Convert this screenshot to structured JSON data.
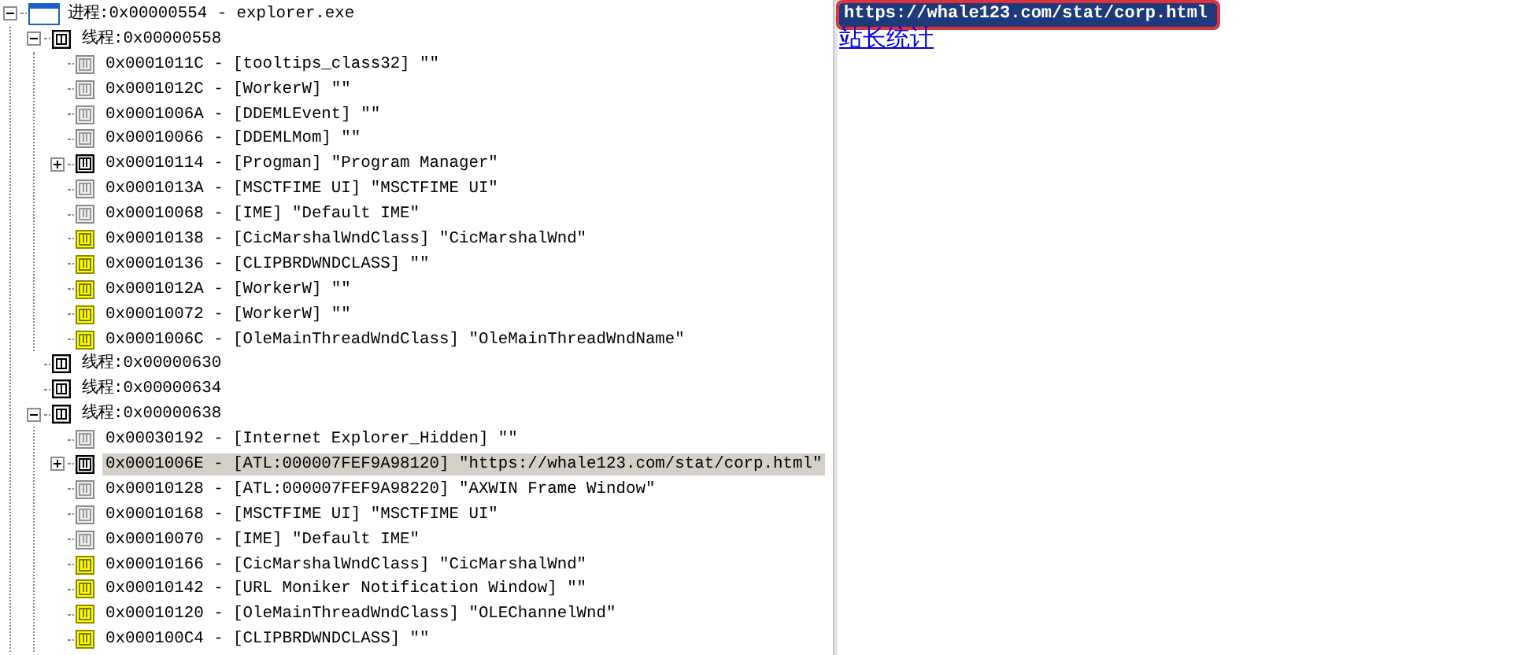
{
  "tree": [
    {
      "kind": "process",
      "label": "进程:0x00000554 - explorer.exe",
      "selected": false,
      "expanded": true,
      "children": [
        {
          "kind": "thread",
          "label": "线程:0x00000558",
          "selected": false,
          "expanded": true,
          "children": [
            {
              "kind": "window-gray",
              "label": "0x0001011C - [tooltips_class32] \"\"",
              "selected": false
            },
            {
              "kind": "window-gray",
              "label": "0x0001012C - [WorkerW] \"\"",
              "selected": false
            },
            {
              "kind": "window-gray",
              "label": "0x0001006A - [DDEMLEvent] \"\"",
              "selected": false
            },
            {
              "kind": "window-gray",
              "label": "0x00010066 - [DDEMLMom] \"\"",
              "selected": false
            },
            {
              "kind": "window-dark",
              "label": "0x00010114 - [Progman] \"Program Manager\"",
              "selected": false,
              "expanded": false
            },
            {
              "kind": "window-gray",
              "label": "0x0001013A - [MSCTFIME UI] \"MSCTFIME UI\"",
              "selected": false
            },
            {
              "kind": "window-gray",
              "label": "0x00010068 - [IME] \"Default IME\"",
              "selected": false
            },
            {
              "kind": "window-yellow",
              "label": "0x00010138 - [CicMarshalWndClass] \"CicMarshalWnd\"",
              "selected": false
            },
            {
              "kind": "window-yellow",
              "label": "0x00010136 - [CLIPBRDWNDCLASS] \"\"",
              "selected": false
            },
            {
              "kind": "window-yellow",
              "label": "0x0001012A - [WorkerW] \"\"",
              "selected": false
            },
            {
              "kind": "window-yellow",
              "label": "0x00010072 - [WorkerW] \"\"",
              "selected": false
            },
            {
              "kind": "window-yellow",
              "label": "0x0001006C - [OleMainThreadWndClass] \"OleMainThreadWndName\"",
              "selected": false
            }
          ]
        },
        {
          "kind": "thread",
          "label": "线程:0x00000630",
          "selected": false
        },
        {
          "kind": "thread",
          "label": "线程:0x00000634",
          "selected": false
        },
        {
          "kind": "thread",
          "label": "线程:0x00000638",
          "selected": false,
          "expanded": true,
          "children": [
            {
              "kind": "window-gray",
              "label": "0x00030192 - [Internet Explorer_Hidden] \"\"",
              "selected": false
            },
            {
              "kind": "window-dark",
              "label": "0x0001006E - [ATL:000007FEF9A98120] \"https://whale123.com/stat/corp.html\"",
              "selected": true,
              "expanded": false
            },
            {
              "kind": "window-gray",
              "label": "0x00010128 - [ATL:000007FEF9A98220] \"AXWIN Frame Window\"",
              "selected": false
            },
            {
              "kind": "window-gray",
              "label": "0x00010168 - [MSCTFIME UI] \"MSCTFIME UI\"",
              "selected": false
            },
            {
              "kind": "window-gray",
              "label": "0x00010070 - [IME] \"Default IME\"",
              "selected": false
            },
            {
              "kind": "window-yellow",
              "label": "0x00010166 - [CicMarshalWndClass] \"CicMarshalWnd\"",
              "selected": false
            },
            {
              "kind": "window-yellow",
              "label": "0x00010142 - [URL Moniker Notification Window] \"\"",
              "selected": false
            },
            {
              "kind": "window-yellow",
              "label": "0x00010120 - [OleMainThreadWndClass] \"OLEChannelWnd\"",
              "selected": false
            },
            {
              "kind": "window-yellow",
              "label": "0x000100C4 - [CLIPBRDWNDCLASS] \"\"",
              "selected": false
            }
          ]
        }
      ]
    }
  ],
  "address_bar": {
    "url": "https://whale123.com/stat/corp.html",
    "highlighted": true
  },
  "page": {
    "link": "站长统计"
  }
}
